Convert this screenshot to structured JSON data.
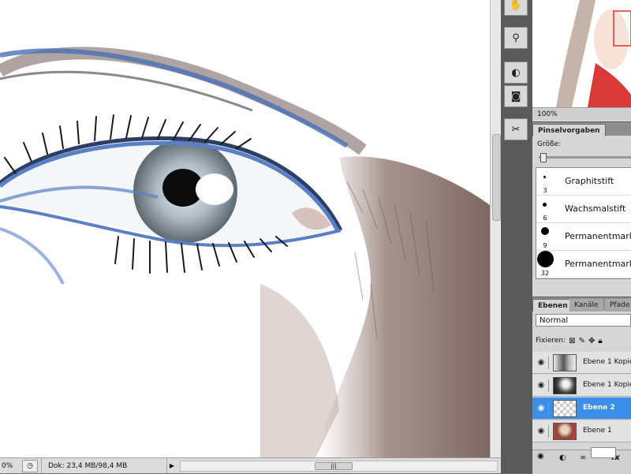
{
  "status": {
    "zoom": "0%",
    "doc_size": "Dok: 23,4 MB/98,4 MB",
    "nav_arrow": "▶",
    "scroll_grip": "|||"
  },
  "navigator": {
    "zoom": "100%"
  },
  "brush_panel": {
    "tab": "Pinselvorgaben",
    "size_label": "Größe:",
    "brushes": [
      {
        "size": "3",
        "name": "Graphitstift"
      },
      {
        "size": "6",
        "name": "Wachsmalstift"
      },
      {
        "size": "9",
        "name": "Permanentmark"
      },
      {
        "size": "32",
        "name": "Permanentmark"
      }
    ]
  },
  "layers_panel": {
    "tabs": [
      "Ebenen",
      "Kanäle",
      "Pfade"
    ],
    "blend_mode": "Normal",
    "lock_label": "Fixieren:",
    "layers": [
      {
        "name": "Ebene 1 Kopie",
        "visible": true,
        "active": false
      },
      {
        "name": "Ebene 1 Kopie",
        "visible": true,
        "active": false
      },
      {
        "name": "Ebene 2",
        "visible": true,
        "active": true
      },
      {
        "name": "Ebene 1",
        "visible": true,
        "active": false
      }
    ],
    "fx_label": "fx"
  },
  "colors": {
    "selection": "#3b8fe8",
    "panel_bg": "#d6d6d6",
    "eyeliner": "#5a7fc4"
  },
  "icons": {
    "tools": [
      "hand-tool-icon",
      "puppet-icon",
      "burn-tool-icon",
      "quick-mask-icon",
      "clone-stamp-icon"
    ],
    "eye": "eye-icon",
    "lock": [
      "lock-transparent-icon",
      "lock-brush-icon",
      "lock-move-icon",
      "lock-all-icon"
    ]
  }
}
